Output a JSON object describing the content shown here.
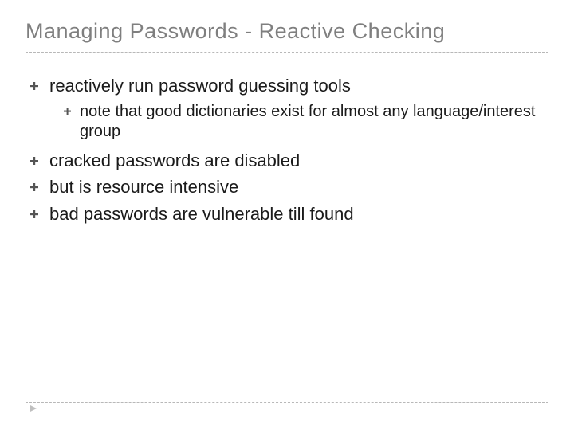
{
  "title": "Managing Passwords - Reactive Checking",
  "bullets": [
    {
      "text": "reactively run password guessing tools",
      "sub": [
        {
          "text": "note that good dictionaries exist for almost any language/interest group"
        }
      ]
    },
    {
      "text": "cracked passwords are disabled"
    },
    {
      "text": "but is resource intensive"
    },
    {
      "text": "bad passwords are vulnerable till found"
    }
  ],
  "colors": {
    "title": "#7f7f7f",
    "text": "#1a1a1a",
    "divider": "#b8b8b8",
    "bullet": "#555555"
  }
}
